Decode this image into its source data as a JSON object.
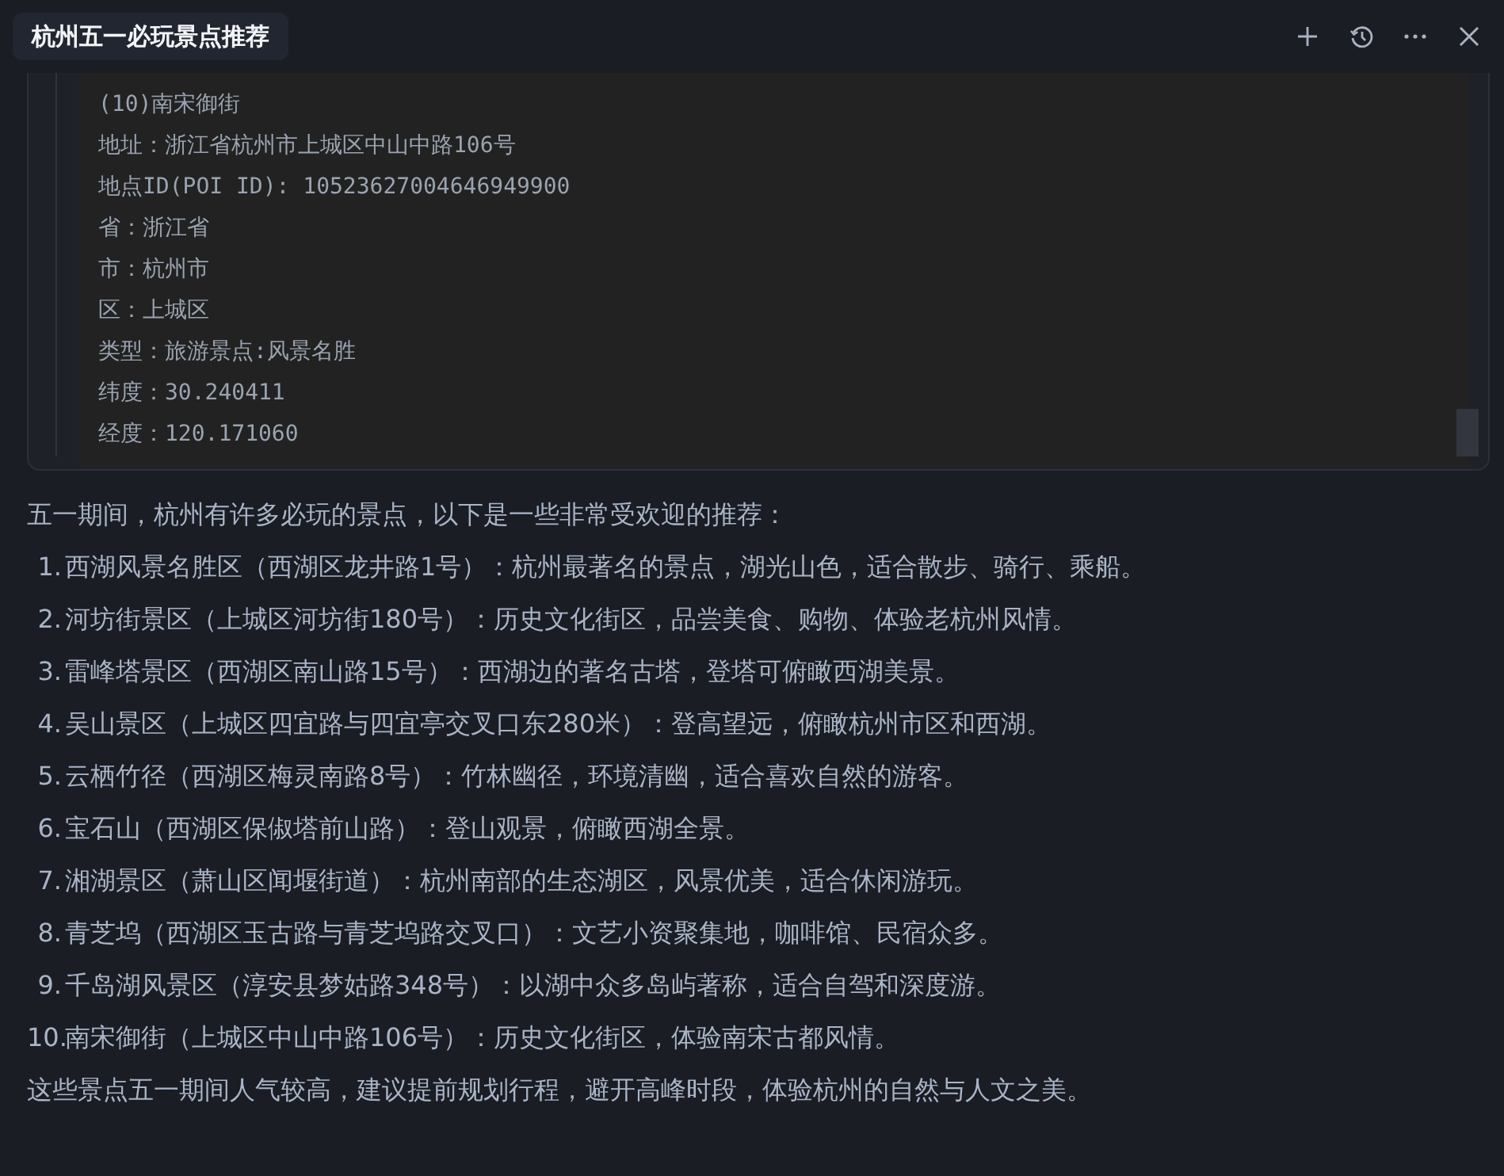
{
  "tab": {
    "title": "杭州五一必玩景点推荐"
  },
  "code_block": {
    "lines": [
      "(10)南宋御街",
      "地址：浙江省杭州市上城区中山中路106号",
      "地点ID(POI ID): 10523627004646949900",
      "省：浙江省",
      "市：杭州市",
      "区：上城区",
      "类型：旅游景点:风景名胜",
      "纬度：30.240411",
      "经度：120.171060"
    ]
  },
  "intro": "五一期间，杭州有许多必玩的景点，以下是一些非常受欢迎的推荐：",
  "items": [
    {
      "number": "1.",
      "text": "西湖风景名胜区（西湖区龙井路1号）：杭州最著名的景点，湖光山色，适合散步、骑行、乘船。"
    },
    {
      "number": "2.",
      "text": "河坊街景区（上城区河坊街180号）：历史文化街区，品尝美食、购物、体验老杭州风情。"
    },
    {
      "number": "3.",
      "text": "雷峰塔景区（西湖区南山路15号）：西湖边的著名古塔，登塔可俯瞰西湖美景。"
    },
    {
      "number": "4.",
      "text": "吴山景区（上城区四宜路与四宜亭交叉口东280米）：登高望远，俯瞰杭州市区和西湖。"
    },
    {
      "number": "5.",
      "text": "云栖竹径（西湖区梅灵南路8号）：竹林幽径，环境清幽，适合喜欢自然的游客。"
    },
    {
      "number": "6.",
      "text": "宝石山（西湖区保俶塔前山路）：登山观景，俯瞰西湖全景。"
    },
    {
      "number": "7.",
      "text": "湘湖景区（萧山区闻堰街道）：杭州南部的生态湖区，风景优美，适合休闲游玩。"
    },
    {
      "number": "8.",
      "text": "青芝坞（西湖区玉古路与青芝坞路交叉口）：文艺小资聚集地，咖啡馆、民宿众多。"
    },
    {
      "number": "9.",
      "text": "千岛湖风景区（淳安县梦姑路348号）：以湖中众多岛屿著称，适合自驾和深度游。"
    },
    {
      "number": "10.",
      "text": "南宋御街（上城区中山中路106号）：历史文化街区，体验南宋古都风情。"
    }
  ],
  "outro": "这些景点五一期间人气较高，建议提前规划行程，避开高峰时段，体验杭州的自然与人文之美。"
}
